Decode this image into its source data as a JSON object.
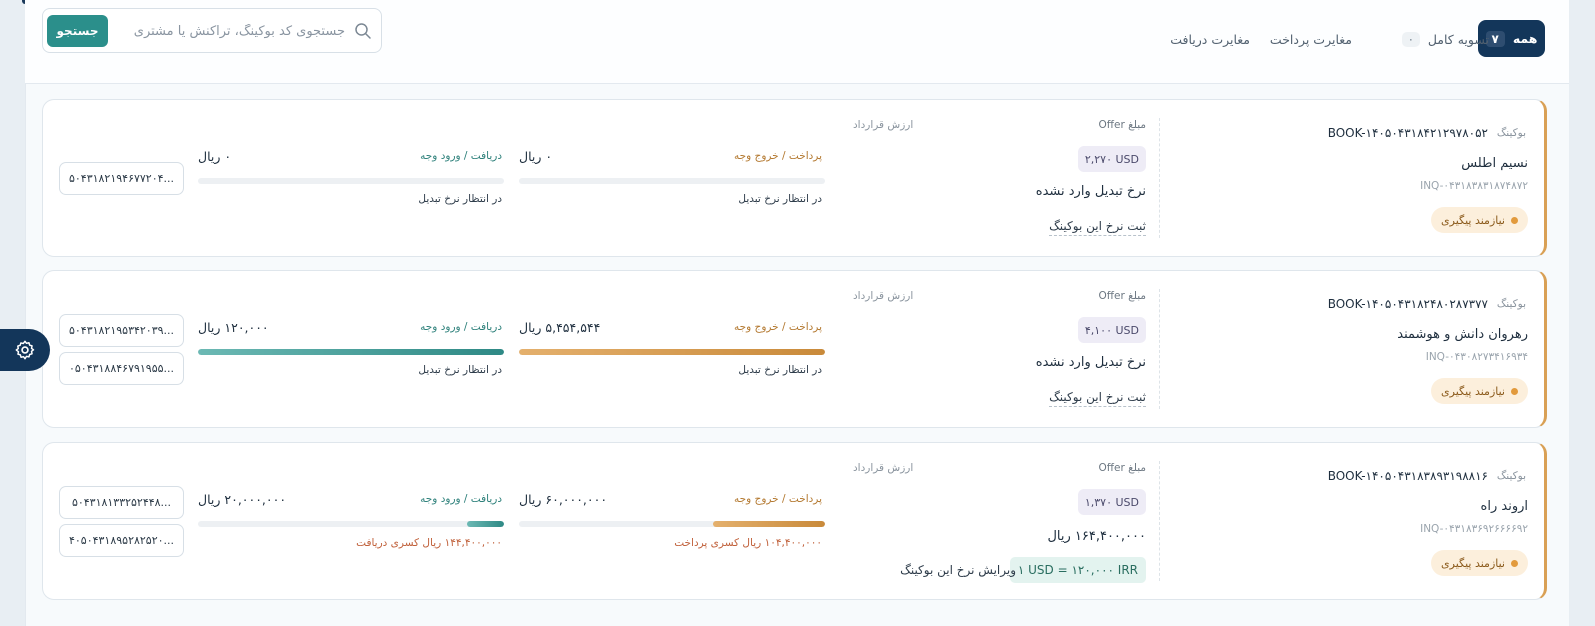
{
  "tabs": {
    "all_label": "همه",
    "all_count": "۷",
    "settled_label": "تسویه کامل",
    "settled_count": "۰",
    "payment_mismatch_label": "مغایرت پرداخت",
    "receipt_mismatch_label": "مغایرت دریافت"
  },
  "search": {
    "placeholder": "جستجوی کد بوکینگ، تراکنش یا مشتری",
    "button_label": "جستجو"
  },
  "labels": {
    "booking": "بوکینگ",
    "offer_amount": "مبلغ Offer",
    "contract_value": "ارزش قرارداد",
    "payment_out": "پرداخت / خروج وجه",
    "receipt_in": "دریافت / ورود وجه",
    "follow_up": "نیازمند پیگیری",
    "rate_not_set": "نرخ تبدیل وارد نشده",
    "set_rate": "ثبت نرخ این بوکینگ",
    "edit_rate": "ویرایش نرخ این بوکینگ",
    "awaiting_rate": "در انتظار نرخ تبدیل"
  },
  "bookings": [
    {
      "code": "BOOK-۱۴۰۵۰۴۳۱۸۴۲۱۲۹۷۸۰۵۲",
      "customer": "نسیم اطلس",
      "inquiry": "INQ-۰۴۳۱۸۳۸۳۱۸۷۴۸۷۲",
      "offer_usd": "۲,۲۷۰ USD",
      "payment_amount": "۰ ریال",
      "payment_progress": 0,
      "payment_note": "در انتظار نرخ تبدیل",
      "receipt_amount": "۰ ریال",
      "receipt_progress": 0,
      "receipt_note": "در انتظار نرخ تبدیل",
      "refs": [
        "۵۰۴۳۱۸۲۱۹۴۶۷۷۲۰۴..."
      ]
    },
    {
      "code": "BOOK-۱۴۰۵۰۴۳۱۸۲۴۸۰۲۸۷۳۷۷",
      "customer": "رهروان دانش و هوشمند",
      "inquiry": "INQ-۰۴۳۰۸۲۷۳۴۱۶۹۳۴",
      "offer_usd": "۴,۱۰۰ USD",
      "payment_amount": "۵,۴۵۴,۵۴۴ ریال",
      "payment_progress": 1,
      "payment_note": "در انتظار نرخ تبدیل",
      "receipt_amount": "۱۲۰,۰۰۰ ریال",
      "receipt_progress": 1,
      "receipt_note": "در انتظار نرخ تبدیل",
      "refs": [
        "۵۰۴۳۱۸۲۱۹۵۳۴۲۰۳۹...",
        "۰۵۰۴۳۱۸۸۴۶۷۹۱۹۵۵..."
      ]
    },
    {
      "code": "BOOK-۱۴۰۵۰۴۳۱۸۳۸۹۳۱۹۸۸۱۶",
      "customer": "اروند راه",
      "inquiry": "INQ-۰۴۳۱۸۳۶۹۲۶۶۶۶۹۲",
      "offer_usd": "۱,۳۷۰ USD",
      "contract_rial": "۱۶۴,۴۰۰,۰۰۰ ریال",
      "rate": "۱ USD = ۱۲۰,۰۰۰ IRR",
      "payment_amount": "۶۰,۰۰۰,۰۰۰ ریال",
      "payment_progress": 0.365,
      "payment_note": "۱۰۴,۴۰۰,۰۰۰ ریال کسری پرداخت",
      "receipt_amount": "۲۰,۰۰۰,۰۰۰ ریال",
      "receipt_progress": 0.122,
      "receipt_note": "۱۴۴,۴۰۰,۰۰۰ ریال کسری دریافت",
      "refs": [
        "۵۰۴۳۱۸۱۳۳۲۵۲۴۴۸...",
        "۴۰۵۰۴۳۱۸۹۵۲۸۲۵۲۰..."
      ]
    }
  ],
  "colors": {
    "primary": "#13365a",
    "accent_teal": "#2b8f8b",
    "accent_gold": "#d9a055"
  }
}
